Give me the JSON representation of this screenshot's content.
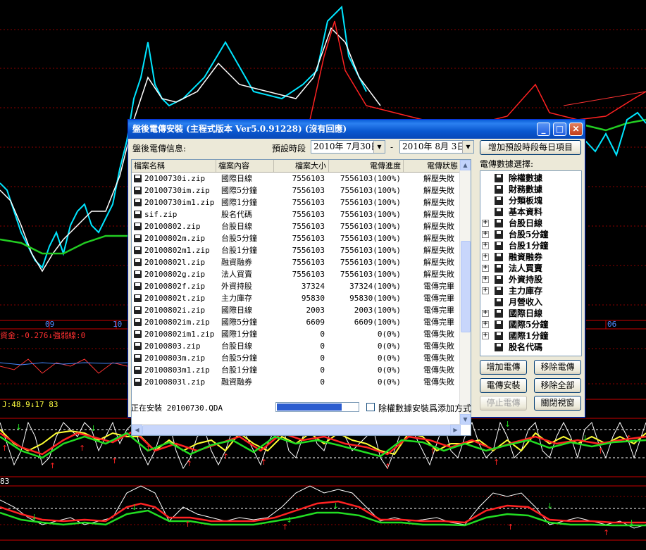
{
  "background": {
    "date_labels": [
      "09",
      "10",
      "06"
    ],
    "indicator1_text": "資金:-0.276↓強弱線:0",
    "indicator2_text": "J:48.9↓17 83",
    "indicator3_text": "83"
  },
  "dialog": {
    "title": "盤後電傳安裝 (主程式版本 Ver5.0.91228) (沒有回應)",
    "info_label": "盤後電傳信息:",
    "period_label": "預設時段",
    "date_from": "2010年  7月30日",
    "date_sep": "-",
    "date_to": "2010年  8月  3日",
    "add_period_button": "增加預設時段每日項目",
    "data_select_label": "電傳數據選擇:",
    "columns": [
      "檔案名稱",
      "檔案內容",
      "檔案大小",
      "電傳進度",
      "電傳狀態"
    ],
    "rows": [
      {
        "name": "20100730i.zip",
        "content": "國際日線",
        "size": "7556103",
        "progress": "7556103(100%)",
        "status": "解壓失敗"
      },
      {
        "name": "20100730im.zip",
        "content": "國際5分鐘",
        "size": "7556103",
        "progress": "7556103(100%)",
        "status": "解壓失敗"
      },
      {
        "name": "20100730im1.zip",
        "content": "國際1分鐘",
        "size": "7556103",
        "progress": "7556103(100%)",
        "status": "解壓失敗"
      },
      {
        "name": "sif.zip",
        "content": "股名代碼",
        "size": "7556103",
        "progress": "7556103(100%)",
        "status": "解壓失敗"
      },
      {
        "name": "20100802.zip",
        "content": "台股日線",
        "size": "7556103",
        "progress": "7556103(100%)",
        "status": "解壓失敗"
      },
      {
        "name": "20100802m.zip",
        "content": "台股5分鐘",
        "size": "7556103",
        "progress": "7556103(100%)",
        "status": "解壓失敗"
      },
      {
        "name": "20100802m1.zip",
        "content": "台股1分鐘",
        "size": "7556103",
        "progress": "7556103(100%)",
        "status": "解壓失敗"
      },
      {
        "name": "20100802l.zip",
        "content": "融資融券",
        "size": "7556103",
        "progress": "7556103(100%)",
        "status": "解壓失敗"
      },
      {
        "name": "20100802g.zip",
        "content": "法人買賣",
        "size": "7556103",
        "progress": "7556103(100%)",
        "status": "解壓失敗"
      },
      {
        "name": "20100802f.zip",
        "content": "外資持股",
        "size": "37324",
        "progress": "37324(100%)",
        "status": "電傳完畢"
      },
      {
        "name": "20100802t.zip",
        "content": "主力庫存",
        "size": "95830",
        "progress": "95830(100%)",
        "status": "電傳完畢"
      },
      {
        "name": "20100802i.zip",
        "content": "國際日線",
        "size": "2003",
        "progress": "2003(100%)",
        "status": "電傳完畢"
      },
      {
        "name": "20100802im.zip",
        "content": "國際5分鐘",
        "size": "6609",
        "progress": "6609(100%)",
        "status": "電傳完畢"
      },
      {
        "name": "20100802im1.zip",
        "content": "國際1分鐘",
        "size": "0",
        "progress": "0(0%)",
        "status": "電傳失敗"
      },
      {
        "name": "20100803.zip",
        "content": "台股日線",
        "size": "0",
        "progress": "0(0%)",
        "status": "電傳失敗"
      },
      {
        "name": "20100803m.zip",
        "content": "台股5分鐘",
        "size": "0",
        "progress": "0(0%)",
        "status": "電傳失敗"
      },
      {
        "name": "20100803m1.zip",
        "content": "台股1分鐘",
        "size": "0",
        "progress": "0(0%)",
        "status": "電傳失敗"
      },
      {
        "name": "20100803l.zip",
        "content": "融資融券",
        "size": "0",
        "progress": "0(0%)",
        "status": "電傳失敗"
      }
    ],
    "tree_items": [
      {
        "label": "除權數據",
        "expandable": false
      },
      {
        "label": "財務數據",
        "expandable": false
      },
      {
        "label": "分類板塊",
        "expandable": false
      },
      {
        "label": "基本資料",
        "expandable": false
      },
      {
        "label": "台股日線",
        "expandable": true
      },
      {
        "label": "台股5分鐘",
        "expandable": true
      },
      {
        "label": "台股1分鐘",
        "expandable": true
      },
      {
        "label": "融資融券",
        "expandable": true
      },
      {
        "label": "法人買賣",
        "expandable": true
      },
      {
        "label": "外資持股",
        "expandable": true
      },
      {
        "label": "主力庫存",
        "expandable": true
      },
      {
        "label": "月營收入",
        "expandable": false
      },
      {
        "label": "國際日線",
        "expandable": true
      },
      {
        "label": "國際5分鐘",
        "expandable": true
      },
      {
        "label": "國際1分鐘",
        "expandable": true
      },
      {
        "label": "股名代碼",
        "expandable": false
      }
    ],
    "buttons": {
      "add_transfer": "增加電傳",
      "remove_transfer": "移除電傳",
      "install": "電傳安裝",
      "remove_all": "移除全部",
      "stop": "停止電傳",
      "close": "關閉視窗"
    },
    "status_text": "正在安裝 20100730.QDA",
    "progress_fraction": 0.8,
    "checkbox_label": "除權數據安裝爲添加方式",
    "checkbox_checked": false
  }
}
